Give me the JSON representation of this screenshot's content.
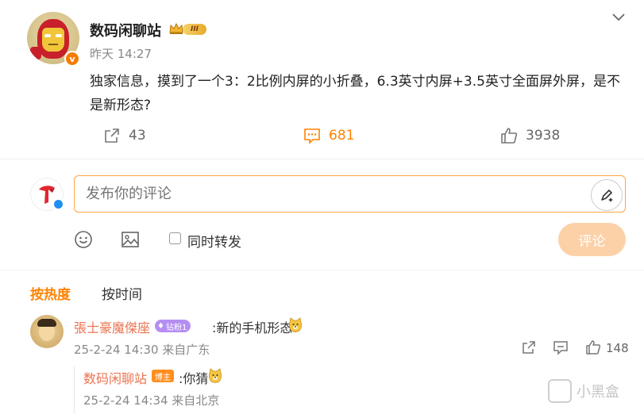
{
  "post": {
    "author": "数码闲聊站",
    "level_badge": "III",
    "verify_mark": "v",
    "time": "昨天 14:27",
    "text": "独家信息，摸到了一个3：2比例内屏的小折叠，6.3英寸内屏+3.5英寸全面屏外屏，是不是新形态?",
    "shares": "43",
    "comments": "681",
    "likes": "3938"
  },
  "composer": {
    "placeholder": "发布你的评论",
    "repost_label": "同时转发",
    "submit_label": "评论"
  },
  "sort_tabs": {
    "hot": "按热度",
    "time": "按时间"
  },
  "comment": {
    "author": "張士豪魔傑座",
    "badge": "钻粉1",
    "text": ":新的手机形态?",
    "meta": "25-2-24 14:30 来自广东",
    "likes": "148"
  },
  "reply": {
    "author": "数码闲聊站",
    "badge": "博主",
    "text": ":你猜",
    "meta": "25-2-24 14:34 来自北京"
  },
  "watermark": "小黑盒",
  "colors": {
    "accent": "#ff8200",
    "username": "#eb7350",
    "input_border": "#ffa640",
    "submit_disabled": "#fcd1a8"
  }
}
